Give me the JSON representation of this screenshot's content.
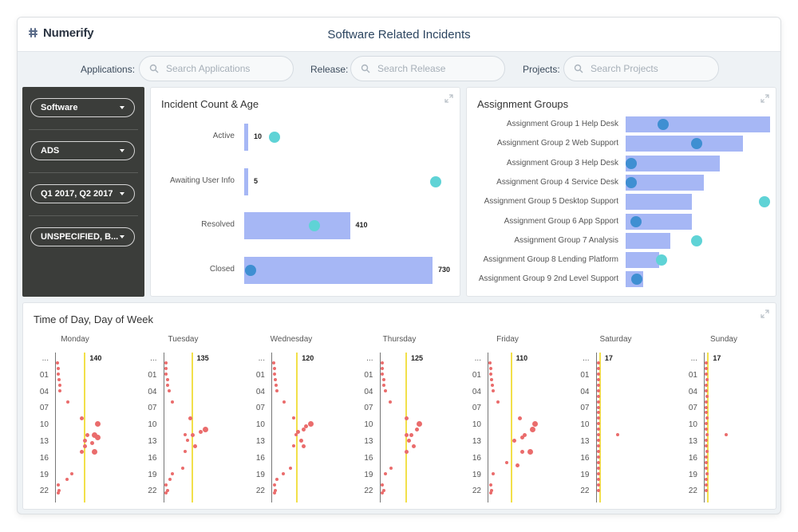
{
  "app": {
    "brand": "Numerify",
    "title": "Software Related Incidents"
  },
  "filters": {
    "applications": {
      "label": "Applications:",
      "placeholder": "Search Applications"
    },
    "release": {
      "label": "Release:",
      "placeholder": "Search Release"
    },
    "projects": {
      "label": "Projects:",
      "placeholder": "Search Projects"
    }
  },
  "sidebar": {
    "dropdowns": [
      {
        "value": "Software"
      },
      {
        "value": "ADS"
      },
      {
        "value": "Q1 2017, Q2 2017"
      },
      {
        "value": "UNSPECIFIED, B..."
      }
    ]
  },
  "colors": {
    "bar": "#a6b7f5",
    "dot_dark": "#3f8fd2",
    "dot_light": "#5fd3d6",
    "point": "#ea6c6c",
    "max_line": "#f2e04a",
    "sidebar": "#3b3d3a"
  },
  "icons": {
    "expand": "expand-icon",
    "search": "search-icon",
    "caret": "chevron-down-icon",
    "brand": "numerify-logo-icon"
  },
  "chart_data": [
    {
      "type": "bar",
      "title": "Incident Count & Age",
      "categories": [
        "Active",
        "Awaiting User Info",
        "Resolved",
        "Closed"
      ],
      "values": [
        10,
        5,
        410,
        730
      ],
      "value_labels": [
        "10",
        "5",
        "410",
        "730"
      ],
      "age_marker_relative": [
        0.15,
        0.96,
        0.35,
        0.03
      ],
      "age_marker_style": [
        "light",
        "light",
        "light",
        "dark"
      ]
    },
    {
      "type": "bar",
      "orientation": "horizontal",
      "title": "Assignment Groups",
      "categories": [
        "Assignment Group 1 Help Desk",
        "Assignment Group 2 Web Support",
        "Assignment Group 3 Help Desk",
        "Assignment Group 4 Service Desk",
        "Assignment Group 5 Desktop Support",
        "Assignment Group 6 App Spport",
        "Assignment Group 7 Analysis",
        "Assignment Group 8 Lending Platform",
        "Assignment Group 9 2nd Level Support"
      ],
      "values": [
        100,
        81,
        65,
        54,
        46,
        46,
        31,
        23,
        12
      ],
      "age_marker_relative": [
        0.26,
        0.49,
        0.04,
        0.04,
        0.96,
        0.07,
        0.49,
        0.25,
        0.08
      ],
      "age_marker_style": [
        "dark",
        "dark",
        "dark",
        "dark",
        "light",
        "dark",
        "light",
        "light",
        "dark"
      ]
    },
    {
      "type": "scatter",
      "title": "Time of Day, Day of Week",
      "y_ticks": [
        "...",
        "01",
        "04",
        "07",
        "10",
        "13",
        "16",
        "19",
        "22"
      ],
      "days": [
        {
          "name": "Monday",
          "max": 140,
          "max_label": "140",
          "x_max": 160,
          "points": [
            [
              2,
              0
            ],
            [
              3,
              1
            ],
            [
              3,
              2
            ],
            [
              5,
              3
            ],
            [
              6,
              4
            ],
            [
              7,
              5
            ],
            [
              22,
              7
            ],
            [
              50,
              10
            ],
            [
              80,
              11
            ],
            [
              75,
              13
            ],
            [
              80,
              13.5
            ],
            [
              60,
              13
            ],
            [
              55,
              14
            ],
            [
              70,
              14.5
            ],
            [
              55,
              15
            ],
            [
              75,
              16
            ],
            [
              50,
              16
            ],
            [
              30,
              20
            ],
            [
              20,
              21
            ],
            [
              3,
              22
            ],
            [
              5,
              23
            ],
            [
              3,
              23.5
            ]
          ]
        },
        {
          "name": "Tuesday",
          "max": 135,
          "max_label": "135",
          "x_max": 160,
          "points": [
            [
              2,
              0
            ],
            [
              3,
              1
            ],
            [
              3,
              2
            ],
            [
              5,
              3
            ],
            [
              6,
              4
            ],
            [
              8,
              5
            ],
            [
              15,
              7
            ],
            [
              50,
              10
            ],
            [
              80,
              12
            ],
            [
              70,
              12.5
            ],
            [
              55,
              13
            ],
            [
              40,
              13
            ],
            [
              45,
              14
            ],
            [
              60,
              15
            ],
            [
              40,
              16
            ],
            [
              35,
              19
            ],
            [
              15,
              20
            ],
            [
              10,
              21
            ],
            [
              3,
              22
            ],
            [
              5,
              23
            ],
            [
              3,
              23.5
            ]
          ]
        },
        {
          "name": "Wednesday",
          "max": 120,
          "max_label": "120",
          "x_max": 160,
          "points": [
            [
              2,
              0
            ],
            [
              3,
              1
            ],
            [
              3,
              2
            ],
            [
              5,
              3
            ],
            [
              6,
              4
            ],
            [
              8,
              5
            ],
            [
              22,
              7
            ],
            [
              40,
              10
            ],
            [
              75,
              11
            ],
            [
              65,
              11.5
            ],
            [
              60,
              12
            ],
            [
              50,
              12.5
            ],
            [
              45,
              13
            ],
            [
              55,
              14
            ],
            [
              60,
              15
            ],
            [
              40,
              15
            ],
            [
              35,
              19
            ],
            [
              20,
              20
            ],
            [
              8,
              21
            ],
            [
              3,
              22
            ],
            [
              5,
              23
            ],
            [
              3,
              23.5
            ]
          ]
        },
        {
          "name": "Thursday",
          "max": 125,
          "max_label": "125",
          "x_max": 160,
          "points": [
            [
              2,
              0
            ],
            [
              3,
              1
            ],
            [
              3,
              2
            ],
            [
              5,
              3
            ],
            [
              6,
              4
            ],
            [
              8,
              5
            ],
            [
              18,
              7
            ],
            [
              50,
              10
            ],
            [
              75,
              11
            ],
            [
              70,
              12
            ],
            [
              60,
              13
            ],
            [
              50,
              13
            ],
            [
              55,
              14
            ],
            [
              65,
              15
            ],
            [
              50,
              16
            ],
            [
              20,
              19
            ],
            [
              8,
              20
            ],
            [
              3,
              22
            ],
            [
              5,
              23
            ],
            [
              3,
              23.5
            ]
          ]
        },
        {
          "name": "Friday",
          "max": 110,
          "max_label": "110",
          "x_max": 160,
          "points": [
            [
              2,
              0
            ],
            [
              3,
              1
            ],
            [
              3,
              2
            ],
            [
              5,
              3
            ],
            [
              6,
              4
            ],
            [
              8,
              5
            ],
            [
              18,
              7
            ],
            [
              60,
              10
            ],
            [
              90,
              11
            ],
            [
              85,
              12
            ],
            [
              70,
              13
            ],
            [
              65,
              13.5
            ],
            [
              50,
              14
            ],
            [
              65,
              16
            ],
            [
              80,
              16
            ],
            [
              35,
              18
            ],
            [
              55,
              18.5
            ],
            [
              8,
              20
            ],
            [
              3,
              22
            ],
            [
              5,
              23
            ],
            [
              3,
              23.5
            ]
          ]
        },
        {
          "name": "Saturday",
          "max": 17,
          "max_label": "17",
          "x_max": 160,
          "points": [
            [
              2,
              0
            ],
            [
              2,
              1
            ],
            [
              2,
              2
            ],
            [
              3,
              3
            ],
            [
              2,
              4
            ],
            [
              2,
              5
            ],
            [
              3,
              6
            ],
            [
              2,
              7
            ],
            [
              2,
              8
            ],
            [
              2,
              9
            ],
            [
              3,
              10
            ],
            [
              2,
              11
            ],
            [
              2,
              12
            ],
            [
              3,
              13
            ],
            [
              40,
              13
            ],
            [
              2,
              14
            ],
            [
              2,
              15
            ],
            [
              3,
              16
            ],
            [
              2,
              17
            ],
            [
              2,
              18
            ],
            [
              2,
              19
            ],
            [
              3,
              20
            ],
            [
              2,
              21
            ],
            [
              2,
              22
            ],
            [
              2,
              23
            ]
          ]
        },
        {
          "name": "Sunday",
          "max": 17,
          "max_label": "17",
          "x_max": 160,
          "points": [
            [
              2,
              0
            ],
            [
              2,
              1
            ],
            [
              2,
              2
            ],
            [
              3,
              3
            ],
            [
              2,
              4
            ],
            [
              2,
              5
            ],
            [
              3,
              6
            ],
            [
              2,
              7
            ],
            [
              2,
              8
            ],
            [
              2,
              9
            ],
            [
              3,
              10
            ],
            [
              2,
              11
            ],
            [
              2,
              12
            ],
            [
              3,
              13
            ],
            [
              40,
              13
            ],
            [
              2,
              14
            ],
            [
              2,
              15
            ],
            [
              3,
              16
            ],
            [
              2,
              17
            ],
            [
              2,
              18
            ],
            [
              2,
              19
            ],
            [
              3,
              20
            ],
            [
              2,
              21
            ],
            [
              2,
              22
            ],
            [
              2,
              23
            ]
          ]
        }
      ]
    }
  ]
}
